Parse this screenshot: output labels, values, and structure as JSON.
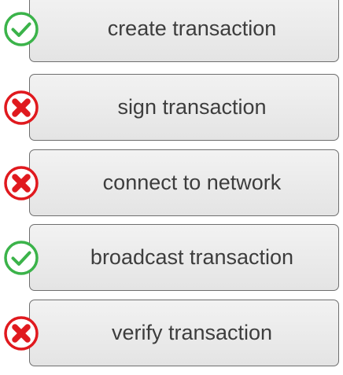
{
  "steps": [
    {
      "label": "create transaction",
      "status": "success",
      "icon": "check-circle-icon"
    },
    {
      "label": "sign transaction",
      "status": "failure",
      "icon": "x-circle-icon"
    },
    {
      "label": "connect to network",
      "status": "failure",
      "icon": "x-circle-icon"
    },
    {
      "label": "broadcast transaction",
      "status": "success",
      "icon": "check-circle-icon"
    },
    {
      "label": "verify transaction",
      "status": "failure",
      "icon": "x-circle-icon"
    }
  ],
  "colors": {
    "success": "#3bb34a",
    "failure": "#e0191e",
    "box_border": "#6e6e6e",
    "box_fill": "#ececec",
    "text": "#3d3d3d"
  }
}
